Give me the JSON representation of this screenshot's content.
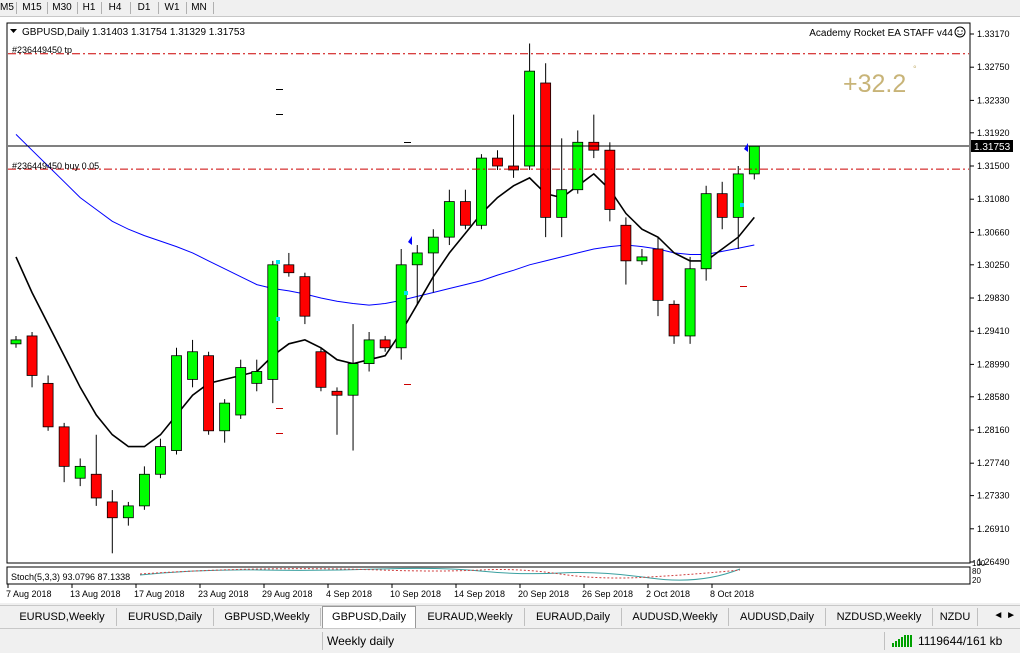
{
  "timeframes": [
    "M5",
    "M15",
    "M30",
    "H1",
    "H4",
    "D1",
    "W1",
    "MN"
  ],
  "chart": {
    "header": "GBPUSD,Daily  1.31403 1.31754 1.31329 1.31753",
    "ea_label": "Academy Rocket EA STAFF v44",
    "profit_label": "+32.2",
    "tp_label": "#236449450 tp",
    "buy_label": "#236449450 buy 0.05",
    "stoch_label": "Stoch(5,3,3) 93.0796 87.1338",
    "stoch_scale": [
      "100",
      "80",
      "20"
    ],
    "current_price": "1.31753",
    "colors": {
      "bull": "#00ff00",
      "bear": "#ff0000",
      "ma_fast": "#000000",
      "ma_slow": "#0000ff",
      "level_line": "#cc0000",
      "profit_text": "#c8b478"
    }
  },
  "tabs": [
    {
      "label": "EURUSD,Weekly",
      "active": false
    },
    {
      "label": "EURUSD,Daily",
      "active": false
    },
    {
      "label": "GBPUSD,Weekly",
      "active": false
    },
    {
      "label": "GBPUSD,Daily",
      "active": true
    },
    {
      "label": "EURAUD,Weekly",
      "active": false
    },
    {
      "label": "EURAUD,Daily",
      "active": false
    },
    {
      "label": "AUDUSD,Weekly",
      "active": false
    },
    {
      "label": "AUDUSD,Daily",
      "active": false
    },
    {
      "label": "NZDUSD,Weekly",
      "active": false
    },
    {
      "label": "NZDU",
      "active": false
    }
  ],
  "status": {
    "profile": "Weekly daily",
    "traffic": "1119644/161 kb"
  },
  "chart_data": {
    "type": "candlestick",
    "title": "",
    "price_axis": [
      "1.33170",
      "1.32750",
      "1.32330",
      "1.31920",
      "1.31500",
      "1.31080",
      "1.30660",
      "1.30250",
      "1.29830",
      "1.29410",
      "1.28990",
      "1.28580",
      "1.28160",
      "1.27740",
      "1.27330",
      "1.26910",
      "1.26490"
    ],
    "ylim": [
      1.2649,
      1.3317
    ],
    "date_labels": [
      "7 Aug 2018",
      "13 Aug 2018",
      "17 Aug 2018",
      "23 Aug 2018",
      "29 Aug 2018",
      "4 Sep 2018",
      "10 Sep 2018",
      "14 Sep 2018",
      "20 Sep 2018",
      "26 Sep 2018",
      "2 Oct 2018",
      "8 Oct 2018"
    ],
    "levels": {
      "tp": 1.3292,
      "buy": 1.3146,
      "current": 1.31753
    },
    "candles": [
      [
        1.2925,
        1.2935,
        1.292,
        1.293
      ],
      [
        1.2935,
        1.294,
        1.287,
        1.2885
      ],
      [
        1.2875,
        1.2885,
        1.2815,
        1.282
      ],
      [
        1.282,
        1.2825,
        1.275,
        1.277
      ],
      [
        1.2755,
        1.278,
        1.2745,
        1.277
      ],
      [
        1.276,
        1.281,
        1.272,
        1.273
      ],
      [
        1.2725,
        1.274,
        1.266,
        1.2705
      ],
      [
        1.2705,
        1.2725,
        1.2695,
        1.272
      ],
      [
        1.272,
        1.277,
        1.2715,
        1.276
      ],
      [
        1.276,
        1.2805,
        1.2755,
        1.2795
      ],
      [
        1.279,
        1.292,
        1.2785,
        1.291
      ],
      [
        1.288,
        1.293,
        1.287,
        1.2915
      ],
      [
        1.291,
        1.2915,
        1.281,
        1.2815
      ],
      [
        1.2815,
        1.2855,
        1.28,
        1.285
      ],
      [
        1.2835,
        1.2905,
        1.283,
        1.2895
      ],
      [
        1.2875,
        1.2905,
        1.2865,
        1.289
      ],
      [
        1.288,
        1.303,
        1.285,
        1.3025
      ],
      [
        1.3025,
        1.304,
        1.301,
        1.3015
      ],
      [
        1.301,
        1.3015,
        1.295,
        1.296
      ],
      [
        1.2915,
        1.292,
        1.2865,
        1.287
      ],
      [
        1.2865,
        1.287,
        1.281,
        1.286
      ],
      [
        1.286,
        1.295,
        1.279,
        1.29
      ],
      [
        1.29,
        1.294,
        1.289,
        1.293
      ],
      [
        1.293,
        1.2935,
        1.2915,
        1.292
      ],
      [
        1.292,
        1.3045,
        1.2905,
        1.3025
      ],
      [
        1.3025,
        1.305,
        1.2975,
        1.304
      ],
      [
        1.304,
        1.307,
        1.299,
        1.306
      ],
      [
        1.306,
        1.312,
        1.305,
        1.3105
      ],
      [
        1.3105,
        1.312,
        1.307,
        1.3075
      ],
      [
        1.3075,
        1.3165,
        1.307,
        1.316
      ],
      [
        1.316,
        1.317,
        1.3145,
        1.315
      ],
      [
        1.315,
        1.3215,
        1.3135,
        1.3145
      ],
      [
        1.315,
        1.3305,
        1.3145,
        1.327
      ],
      [
        1.3255,
        1.328,
        1.306,
        1.3085
      ],
      [
        1.3085,
        1.3185,
        1.306,
        1.312
      ],
      [
        1.312,
        1.3195,
        1.3115,
        1.318
      ],
      [
        1.318,
        1.3215,
        1.316,
        1.317
      ],
      [
        1.317,
        1.318,
        1.308,
        1.3095
      ],
      [
        1.3075,
        1.3085,
        1.3,
        1.303
      ],
      [
        1.303,
        1.3045,
        1.3025,
        1.3035
      ],
      [
        1.3045,
        1.306,
        1.296,
        1.298
      ],
      [
        1.2975,
        1.298,
        1.2925,
        1.2935
      ],
      [
        1.2935,
        1.3035,
        1.2925,
        1.302
      ],
      [
        1.302,
        1.3125,
        1.3005,
        1.3115
      ],
      [
        1.3115,
        1.313,
        1.307,
        1.3085
      ],
      [
        1.3085,
        1.315,
        1.3045,
        1.314
      ],
      [
        1.314,
        1.3175,
        1.3133,
        1.3175
      ]
    ],
    "ma_fast": [
      1.3035,
      1.299,
      1.295,
      1.291,
      1.287,
      1.2835,
      1.281,
      1.2795,
      1.2795,
      1.281,
      1.2835,
      1.286,
      1.2875,
      1.288,
      1.2885,
      1.289,
      1.291,
      1.2925,
      1.293,
      1.292,
      1.2905,
      1.29,
      1.2905,
      1.291,
      1.294,
      1.2975,
      1.301,
      1.304,
      1.3065,
      1.309,
      1.311,
      1.3125,
      1.3135,
      1.3115,
      1.311,
      1.3125,
      1.314,
      1.312,
      1.309,
      1.307,
      1.306,
      1.304,
      1.303,
      1.303,
      1.3045,
      1.306,
      1.3085
    ],
    "ma_slow": [
      1.319,
      1.317,
      1.315,
      1.313,
      1.311,
      1.3095,
      1.308,
      1.307,
      1.3062,
      1.3055,
      1.3048,
      1.304,
      1.303,
      1.302,
      1.301,
      1.3,
      1.2995,
      1.2992,
      1.2988,
      1.2983,
      1.2979,
      1.2976,
      1.2974,
      1.2976,
      1.298,
      1.2985,
      1.299,
      1.2995,
      1.3,
      1.3005,
      1.3012,
      1.3018,
      1.3025,
      1.303,
      1.3035,
      1.304,
      1.3045,
      1.3048,
      1.305,
      1.3048,
      1.3045,
      1.304,
      1.3038,
      1.3038,
      1.3042,
      1.3046,
      1.305
    ]
  }
}
